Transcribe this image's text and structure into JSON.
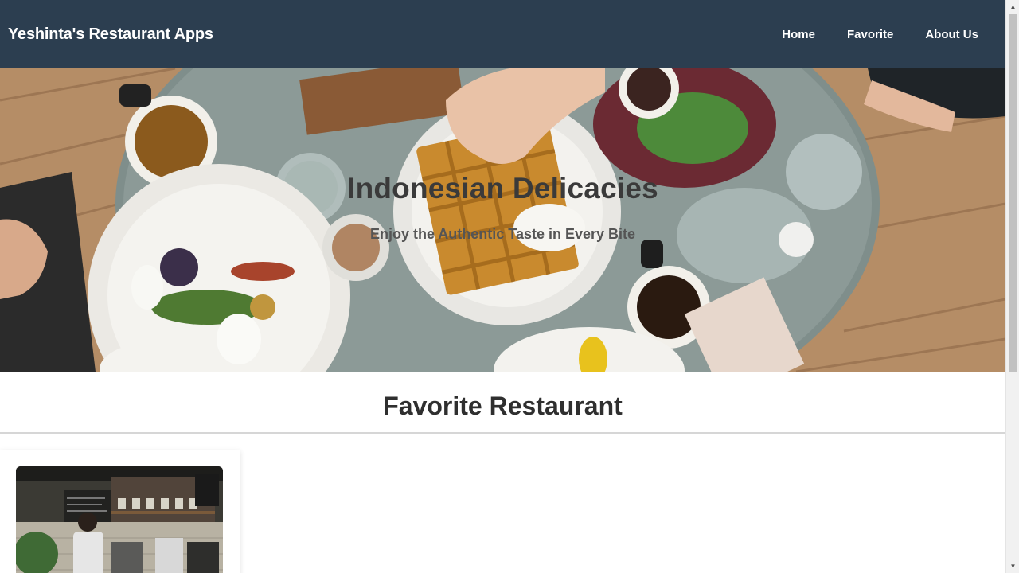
{
  "header": {
    "title": "Yeshinta's Restaurant Apps",
    "nav": [
      {
        "label": "Home"
      },
      {
        "label": "Favorite"
      },
      {
        "label": "About Us"
      }
    ]
  },
  "hero": {
    "title": "Indonesian Delicacies",
    "subtitle": "Enjoy the Authentic Taste in Every Bite"
  },
  "main": {
    "section_title": "Favorite Restaurant"
  },
  "colors": {
    "header_bg": "#2c3e50",
    "header_text": "#ffffff",
    "divider": "#d6d6d6"
  }
}
